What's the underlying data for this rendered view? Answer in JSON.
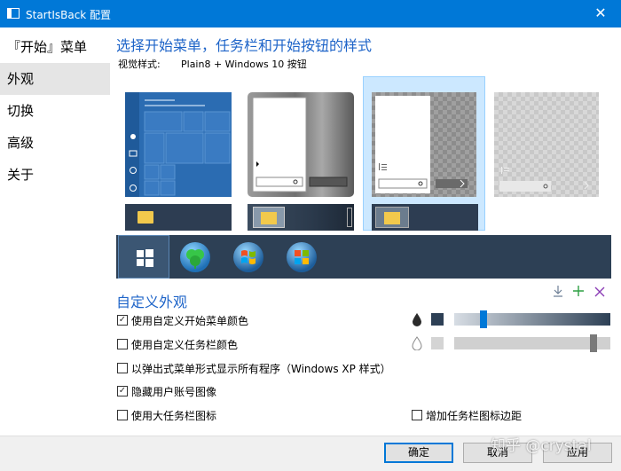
{
  "window": {
    "title": "StartIsBack 配置",
    "close_glyph": "✕"
  },
  "sidebar": {
    "items": [
      {
        "label": "『开始』菜单"
      },
      {
        "label": "外观"
      },
      {
        "label": "切换"
      },
      {
        "label": "高级"
      },
      {
        "label": "关于"
      }
    ]
  },
  "main": {
    "heading": "选择开始菜单，任务栏和开始按钮的样式",
    "visual_style_label": "视觉样式:",
    "visual_style_value": "Plain8 + Windows 10 按钮",
    "custom_heading": "自定义外观",
    "options": [
      {
        "label": "使用自定义开始菜单颜色",
        "checked": true
      },
      {
        "label": "使用自定义任务栏颜色",
        "checked": false
      },
      {
        "label": "以弹出式菜单形式显示所有程序（Windows XP 样式）",
        "checked": false
      },
      {
        "label": "隐藏用户账号图像",
        "checked": true
      },
      {
        "label": "使用大任务栏图标",
        "checked": false
      }
    ],
    "extra_option": {
      "label": "增加任务栏图标边距",
      "checked": false
    },
    "menu_color_opacity": 0.17,
    "taskbar_color_opacity": 0.91,
    "check_glyph": "✓"
  },
  "footer": {
    "ok": "确定",
    "cancel": "取消",
    "apply": "应用"
  },
  "watermark": "知乎 @crystal"
}
